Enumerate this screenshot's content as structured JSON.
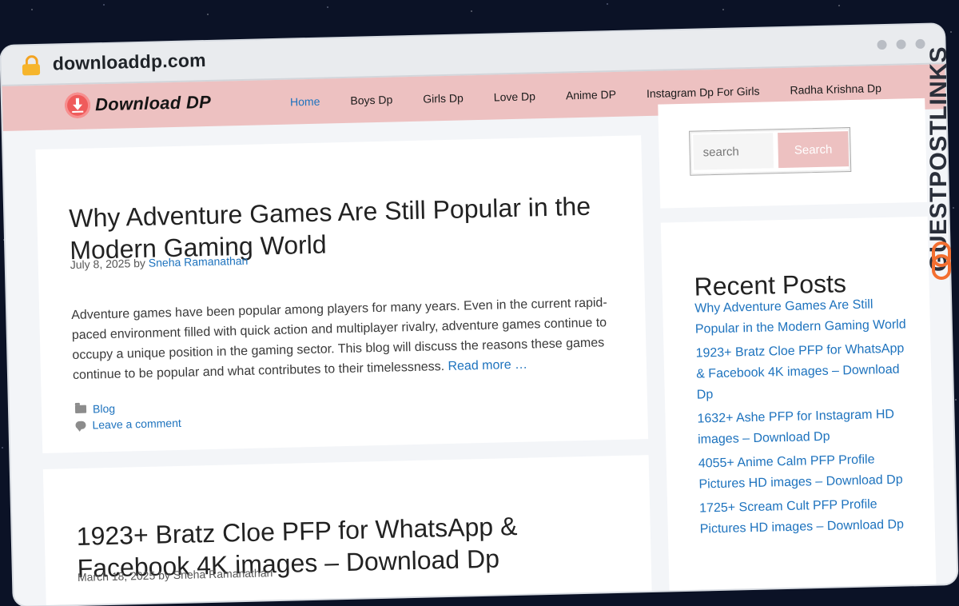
{
  "browser": {
    "url": "downloaddp.com"
  },
  "site": {
    "logo_text": "Download DP",
    "menu": [
      "Home",
      "Boys Dp",
      "Girls Dp",
      "Love Dp",
      "Anime DP",
      "Instagram Dp For Girls",
      "Radha Krishna Dp"
    ],
    "active_menu": "Home"
  },
  "posts": [
    {
      "title": "Why Adventure Games Are Still Popular in the Modern Gaming World",
      "date": "July 8, 2025",
      "by": "by",
      "author": "Sneha Ramanathan",
      "excerpt": "Adventure games have been popular among players for many years. Even in the current rapid-paced environment filled with quick action and multiplayer rivalry, adventure games continue to occupy a unique position in the gaming sector. This blog will discuss the reasons these games continue to be popular and what contributes to their timelessness. Read more …",
      "read_more": "Read more",
      "category": "Blog",
      "comment_link": "Leave a comment"
    },
    {
      "title": "1923+ Bratz Cloe PFP for WhatsApp & Facebook 4K images – Download Dp",
      "meta_partial": "March 18, 2025 by Sneha Ramanathan"
    }
  ],
  "sidebar": {
    "search_placeholder": "search",
    "search_button": "Search",
    "recent_title": "Recent Posts",
    "recent_posts": [
      "Why Adventure Games Are Still Popular in the Modern Gaming World",
      "1923+ Bratz Cloe PFP for WhatsApp & Facebook 4K images – Download Dp",
      "1632+ Ashe PFP for Instagram HD images – Download Dp",
      "4055+ Anime Calm PFP Profile Pictures HD images – Download Dp",
      "1725+ Scream Cult PFP Profile Pictures HD images – Download Dp"
    ]
  },
  "watermark": "GUESTPOSTLINKS",
  "colors": {
    "nav_bg": "#edc1c1",
    "link": "#1e73be",
    "brand_orange": "#f36f31"
  }
}
